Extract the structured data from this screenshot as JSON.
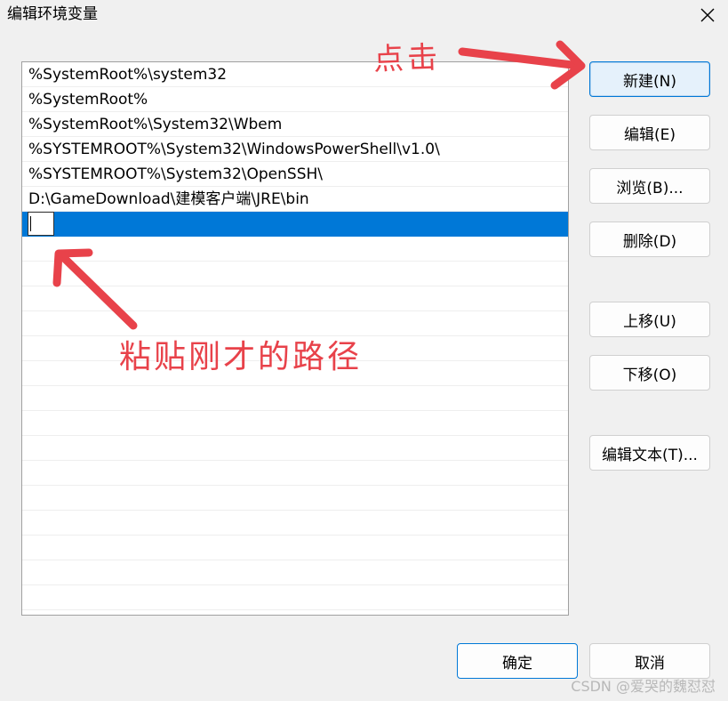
{
  "window": {
    "title": "编辑环境变量"
  },
  "list": {
    "items": [
      "%SystemRoot%\\system32",
      "%SystemRoot%",
      "%SystemRoot%\\System32\\Wbem",
      "%SYSTEMROOT%\\System32\\WindowsPowerShell\\v1.0\\",
      "%SYSTEMROOT%\\System32\\OpenSSH\\",
      "D:\\GameDownload\\建模客户端\\JRE\\bin"
    ],
    "editing_value": ""
  },
  "buttons": {
    "new": "新建(N)",
    "edit": "编辑(E)",
    "browse": "浏览(B)...",
    "delete": "删除(D)",
    "move_up": "上移(U)",
    "move_down": "下移(O)",
    "edit_text": "编辑文本(T)...",
    "ok": "确定",
    "cancel": "取消"
  },
  "annotations": {
    "click_note": "点击",
    "paste_note": "粘贴刚才的路径",
    "color": "#e8424a"
  },
  "watermark": "CSDN @爱哭的魏怼怼"
}
